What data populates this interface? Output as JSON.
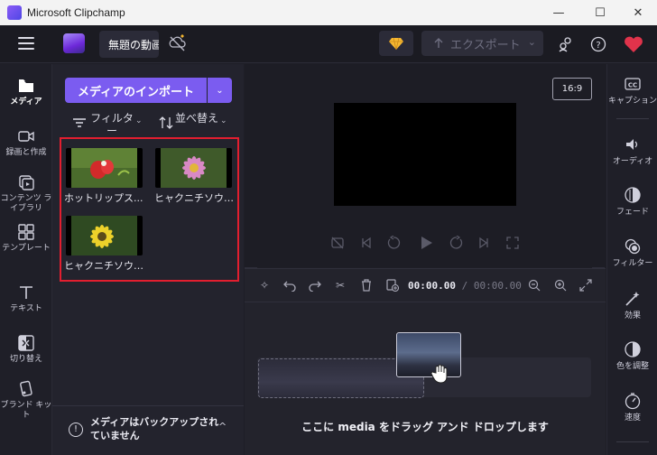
{
  "window": {
    "title": "Microsoft Clipchamp",
    "minimize": "—",
    "maximize": "☐",
    "close": "✕"
  },
  "header": {
    "project_name": "無題の動画",
    "export_label": "エクスポート",
    "export_icon": "upload-icon"
  },
  "left_nav": {
    "items": [
      {
        "label": "メディア",
        "icon": "folder-icon",
        "active": true
      },
      {
        "label": "録画と作成",
        "icon": "camera-icon"
      },
      {
        "label": "コンテンツ ライブラリ",
        "icon": "library-icon"
      },
      {
        "label": "テンプレート",
        "icon": "templates-icon"
      },
      {
        "label": "テキスト",
        "icon": "text-icon"
      },
      {
        "label": "切り替え",
        "icon": "transitions-icon"
      },
      {
        "label": "ブランド キット",
        "icon": "brand-kit-icon"
      }
    ]
  },
  "media": {
    "import_label": "メディアのインポート",
    "filter_label": "フィルター",
    "sort_label": "並べ替え",
    "items": [
      {
        "label": "ホットリップス..."
      },
      {
        "label": "ヒャクニチソウ_..."
      },
      {
        "label": "ヒャクニチソウ_..."
      }
    ],
    "backup_text": "メディアはバックアップされていません"
  },
  "preview": {
    "aspect_ratio": "16:9"
  },
  "timeline": {
    "current_time": "00:00.00",
    "separator": "/",
    "total_time": "00:00.00",
    "drop_hint": "ここに media をドラッグ アンド ドロップします"
  },
  "right_nav": {
    "items": [
      {
        "label": "キャプション",
        "icon": "captions-icon"
      },
      {
        "label": "オーディオ",
        "icon": "audio-icon"
      },
      {
        "label": "フェード",
        "icon": "fade-icon"
      },
      {
        "label": "フィルター",
        "icon": "filter-icon"
      },
      {
        "label": "効果",
        "icon": "effects-icon"
      },
      {
        "label": "色を調整",
        "icon": "color-adjust-icon"
      },
      {
        "label": "速度",
        "icon": "speed-icon"
      }
    ]
  },
  "colors": {
    "accent": "#7b5cf0",
    "selection_border": "#e21e2f",
    "premium": "#f5b731"
  }
}
